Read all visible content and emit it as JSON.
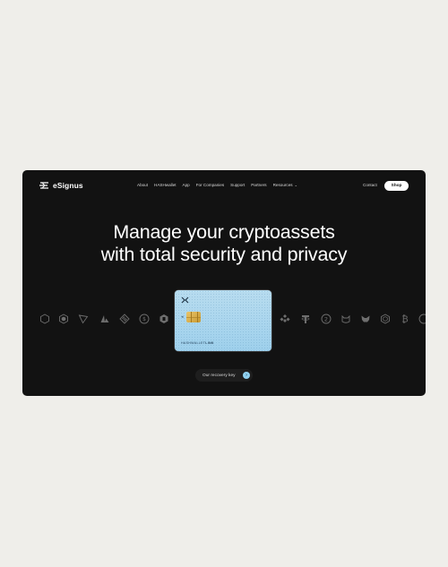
{
  "brand": {
    "name": "eSignus"
  },
  "nav": {
    "items": [
      "About",
      "HASHwallet",
      "App",
      "For Companies",
      "Support",
      "Partners",
      "Resources"
    ],
    "contact": "Contact",
    "shop": "Shop"
  },
  "hero": {
    "line1": "Manage your cryptoassets",
    "line2": "with total security and privacy"
  },
  "card": {
    "brand_prefix": "HASHWALLET",
    "brand_suffix": "LINK",
    "color": "#a9d7ef"
  },
  "cta": {
    "label": "Our recovery key",
    "arrow": "›"
  },
  "coins": [
    "generic-coin-icon",
    "cronos-icon",
    "tron-icon",
    "avalanche-icon",
    "binance-alt-icon",
    "usdc-icon",
    "polygon-icon",
    "binance-icon",
    "tether-icon",
    "two-icon",
    "cat-icon",
    "metamask-icon",
    "shield-icon",
    "bitcoin-icon",
    "generic-coin-icon"
  ],
  "colors": {
    "background": "#efeeea",
    "frame": "#121212",
    "accent": "#8fd0f0"
  }
}
